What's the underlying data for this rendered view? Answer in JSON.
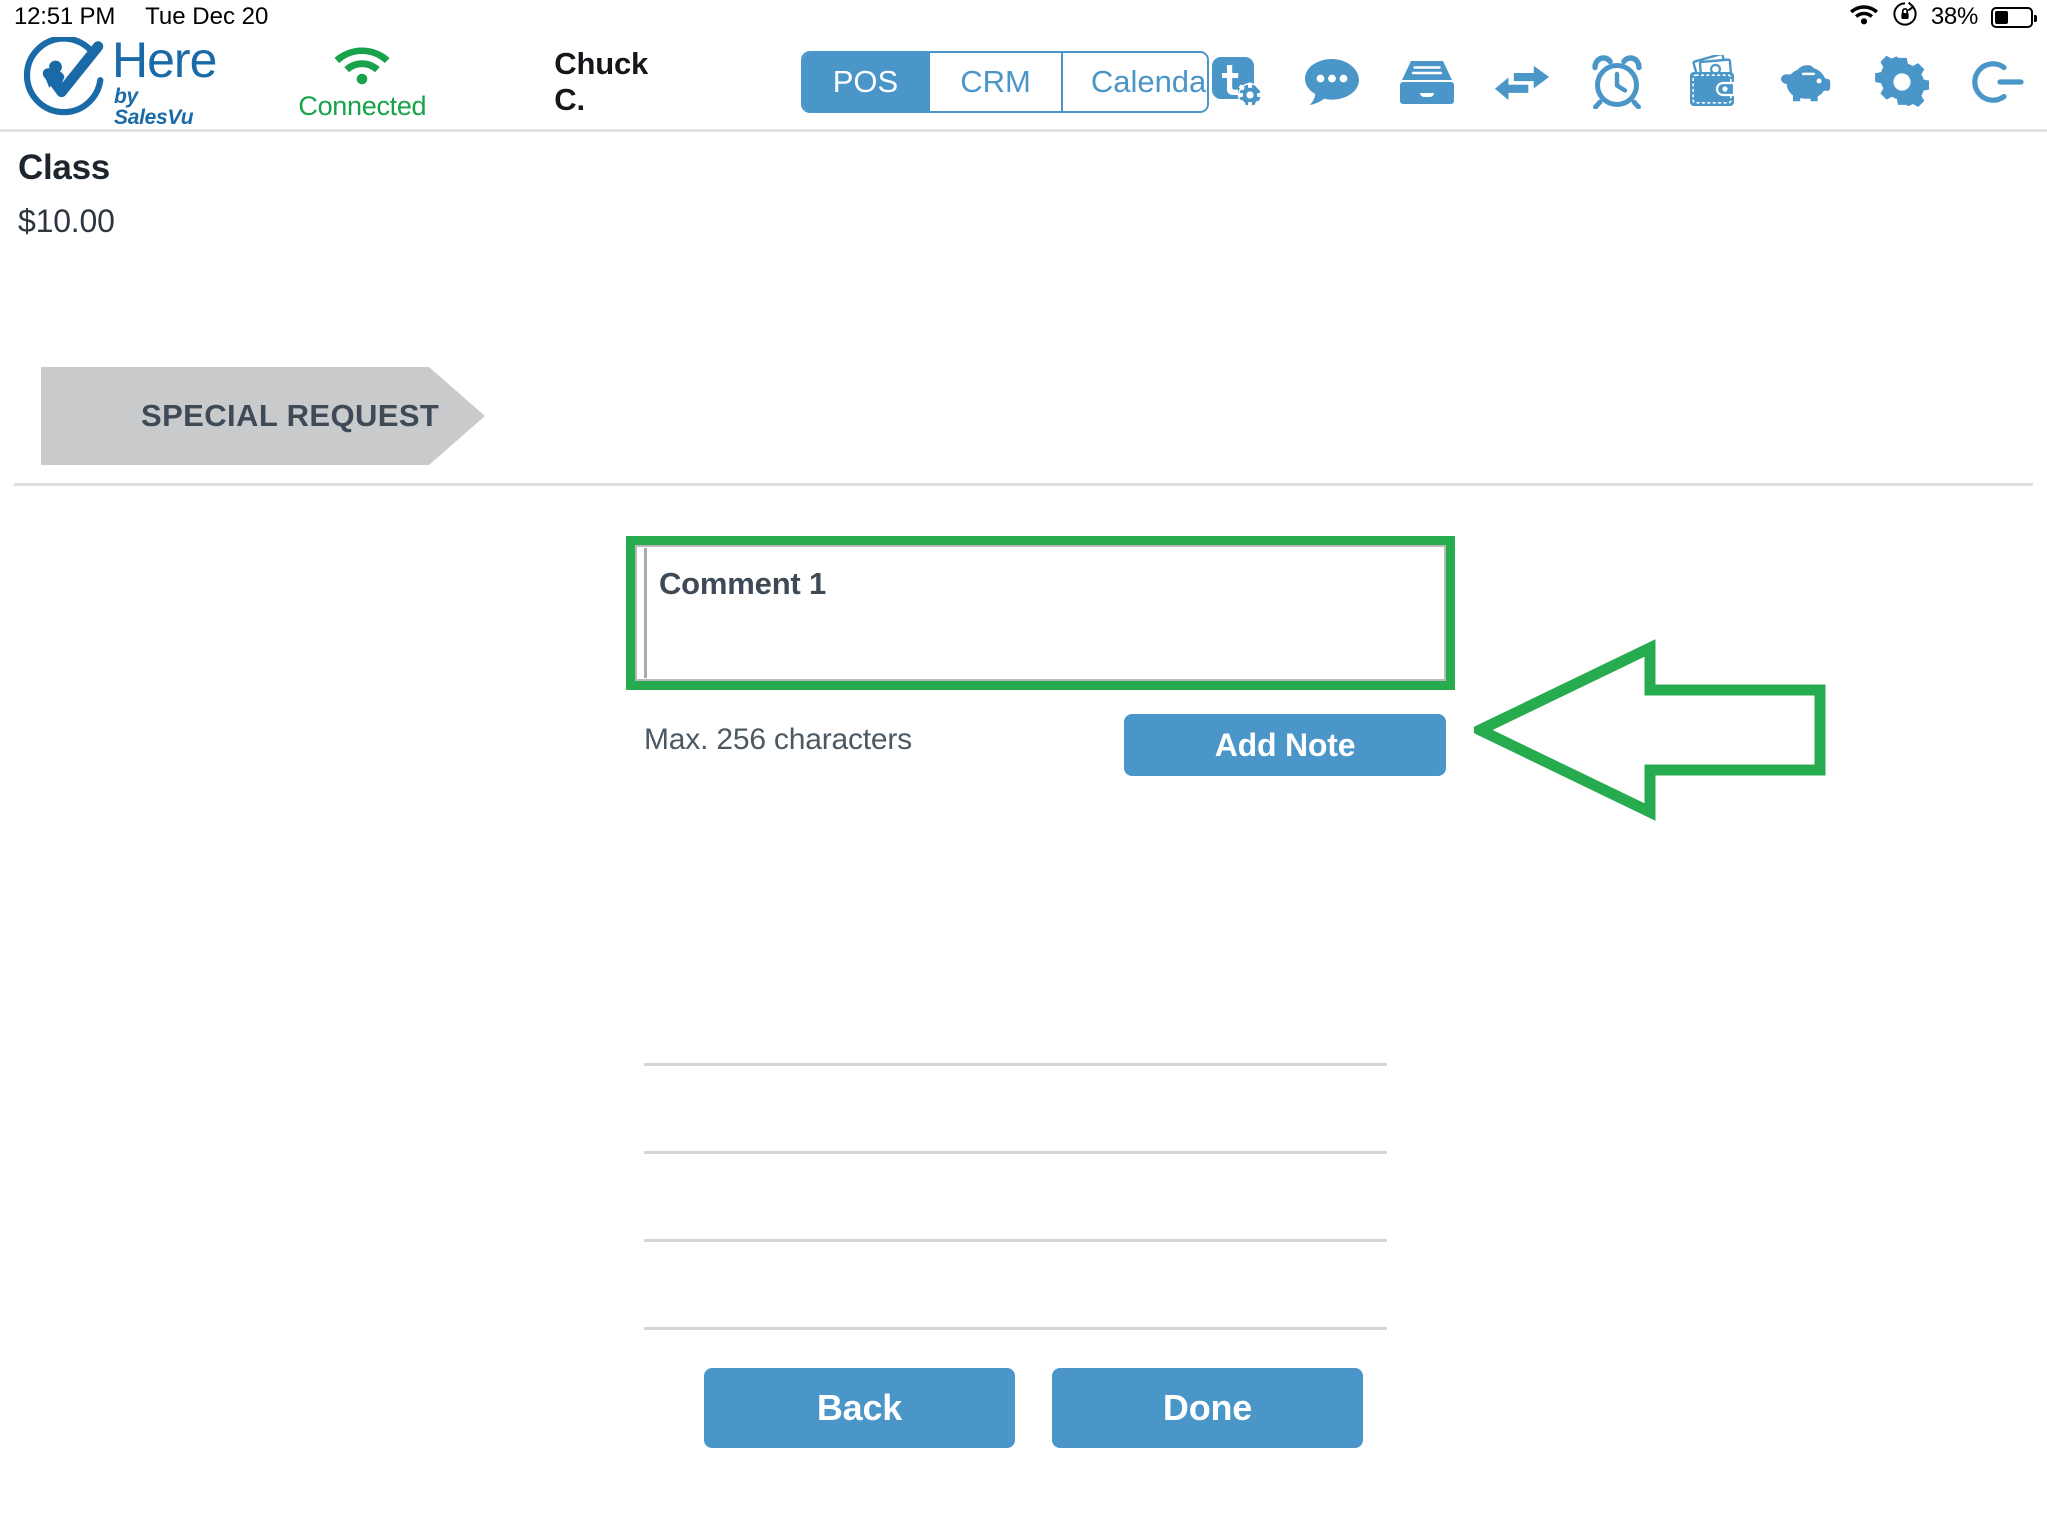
{
  "status_bar": {
    "time": "12:51 PM",
    "date": "Tue Dec 20",
    "battery_percent": "38%",
    "battery_level": 38,
    "wifi_icon": "wifi-icon",
    "rotation_lock_icon": "rotation-lock-icon",
    "battery_icon": "battery-icon"
  },
  "header": {
    "logo_name": "Here",
    "logo_tagline": "by SalesVu",
    "logo_icon": "here-salesvu-logo-icon",
    "connection_status": "Connected",
    "connection_icon": "wifi-connected-icon",
    "user_name": "Chuck C.",
    "segments": [
      {
        "label": "POS",
        "active": true
      },
      {
        "label": "CRM",
        "active": false
      },
      {
        "label": "Calendar",
        "active": false
      }
    ],
    "toolbar_icons": [
      "ticket-settings-icon",
      "chat-bubble-icon",
      "file-drawer-icon",
      "transfer-arrows-icon",
      "alarm-clock-icon",
      "wallet-cash-icon",
      "piggy-bank-icon",
      "gear-settings-icon",
      "logout-icon"
    ]
  },
  "main": {
    "item_title": "Class",
    "item_price": "$10.00",
    "breadcrumb_label": "SPECIAL REQUEST",
    "note_value": "Comment 1",
    "note_placeholder": "",
    "max_chars_hint": "Max. 256 characters",
    "add_note_label": "Add Note",
    "empty_rows": 4
  },
  "footer": {
    "back_label": "Back",
    "done_label": "Done"
  },
  "annotations": {
    "highlight_color": "#27ab4f",
    "arrow_color": "#27ab4f",
    "arrow_direction": "left",
    "arrow_target": "add-note-button"
  },
  "colors": {
    "brand_blue": "#4a96c8",
    "logo_blue": "#1a6aa8",
    "connected_green": "#16a34a",
    "breadcrumb_gray": "#c8cacc",
    "text_dark": "#1c252e"
  }
}
